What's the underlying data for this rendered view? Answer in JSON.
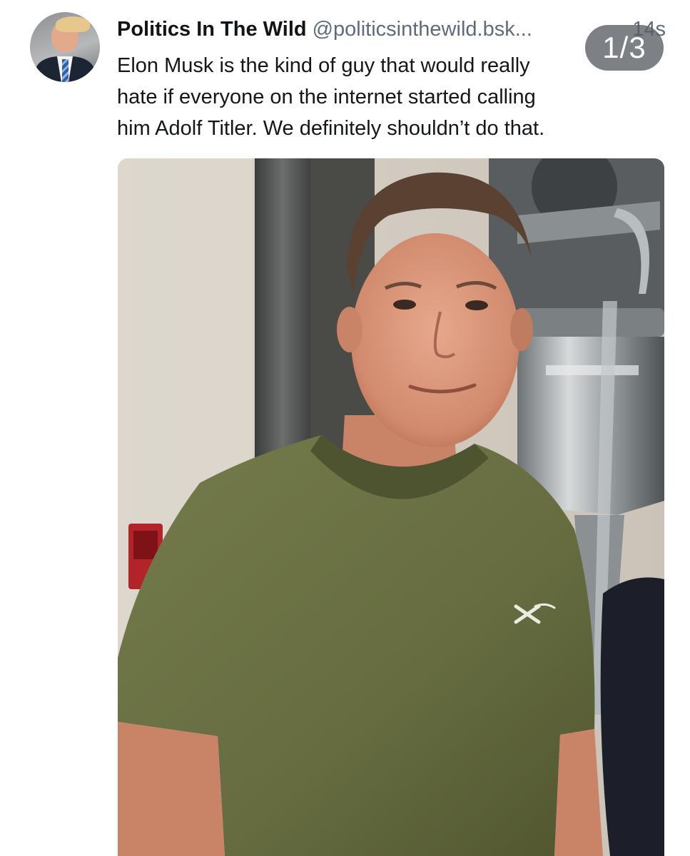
{
  "post": {
    "author": {
      "display_name": "Politics In The Wild",
      "handle": "@politicsinthewild.bsk..."
    },
    "timestamp": "14s",
    "text_lines": [
      "Elon Musk is the kind of guy that would really",
      "hate if everyone on the internet started calling",
      "him Adolf Titler. We definitely shouldn’t do that."
    ],
    "media": {
      "counter": "1/3"
    }
  },
  "colors": {
    "name": "#111418",
    "handle": "#5f6b7a",
    "shirt": "#6b7345",
    "badge": "#585c62"
  },
  "icons": {
    "avatar": "profile-photo",
    "shirt_logo": "x-logo"
  }
}
